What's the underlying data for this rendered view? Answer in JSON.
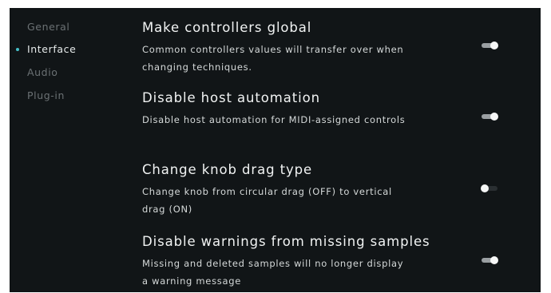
{
  "sidebar": {
    "items": [
      {
        "label": "General",
        "active": false
      },
      {
        "label": "Interface",
        "active": true
      },
      {
        "label": "Audio",
        "active": false
      },
      {
        "label": "Plug-in",
        "active": false
      }
    ]
  },
  "settings": [
    {
      "title": "Make controllers global",
      "description": "Common controllers values will transfer over when changing techniques.",
      "enabled": true
    },
    {
      "title": "Disable host automation",
      "description": "Disable host automation for MIDI-assigned controls",
      "enabled": true
    },
    {
      "title": "Change knob drag type",
      "description": "Change knob from circular drag (OFF) to vertical drag (ON)",
      "enabled": false
    },
    {
      "title": "Disable warnings from missing samples",
      "description": "Missing and deleted samples will no longer display a warning message",
      "enabled": true
    }
  ],
  "colors": {
    "background": "#111517",
    "accent": "#46c0c9",
    "text_primary": "#f1f3f3",
    "text_muted": "#6b7174",
    "toggle_on_track": "#9a9fa2",
    "toggle_knob": "#f6f7f7"
  }
}
